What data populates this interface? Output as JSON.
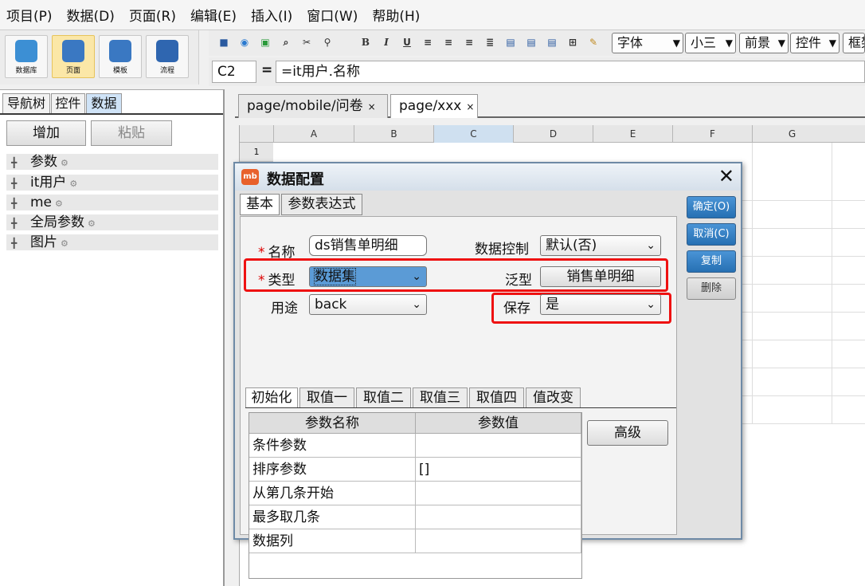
{
  "menu": [
    "项目(P)",
    "数据(D)",
    "页面(R)",
    "编辑(E)",
    "插入(I)",
    "窗口(W)",
    "帮助(H)"
  ],
  "big_tools": [
    {
      "label": "数据库",
      "icon": "database-icon"
    },
    {
      "label": "页面",
      "icon": "page-icon"
    },
    {
      "label": "模板",
      "icon": "template-icon"
    },
    {
      "label": "流程",
      "icon": "flow-icon"
    }
  ],
  "toolbar": {
    "font_family": "字体",
    "font_size": "小三",
    "select3": "前景",
    "select4": "控件",
    "select5": "框架"
  },
  "formula_bar": {
    "cell_ref": "C2",
    "eq": "=",
    "formula": "=it用户.名称"
  },
  "left_panel": {
    "tabs": [
      "导航树",
      "控件",
      "数据"
    ],
    "add_button": "增加",
    "paste_button": "粘贴",
    "tree": [
      "参数",
      "it用户",
      "me",
      "全局参数",
      "图片"
    ]
  },
  "doc_tabs": [
    {
      "label": "page/mobile/问卷",
      "close": "×"
    },
    {
      "label": "page/xxx",
      "close": "×"
    }
  ],
  "grid": {
    "columns": [
      "A",
      "B",
      "C",
      "D",
      "E",
      "F",
      "G"
    ],
    "first_row": "1"
  },
  "dialog": {
    "title": "数据配置",
    "logo": "mb",
    "close": "✕",
    "tabs": [
      "基本",
      "参数表达式"
    ],
    "name_label": "名称",
    "name_value": "ds销售单明细",
    "data_control_label": "数据控制",
    "data_control_value": "默认(否)",
    "type_label": "类型",
    "type_value": "数据集",
    "generic_label": "泛型",
    "generic_value": "销售单明细",
    "usage_label": "用途",
    "usage_value": "back",
    "save_label": "保存",
    "save_value": "是",
    "inner_tabs": [
      "初始化",
      "取值一",
      "取值二",
      "取值三",
      "取值四",
      "值改变"
    ],
    "table_headers": [
      "参数名称",
      "参数值"
    ],
    "table_rows": [
      {
        "name": "条件参数",
        "value": ""
      },
      {
        "name": "排序参数",
        "value": "[]"
      },
      {
        "name": "从第几条开始",
        "value": ""
      },
      {
        "name": "最多取几条",
        "value": ""
      },
      {
        "name": "数据列",
        "value": ""
      }
    ],
    "advanced_button": "高级",
    "side_buttons": [
      "确定(O)",
      "取消(C)",
      "复制",
      "删除"
    ]
  },
  "colors": {
    "highlight": "#ee1111",
    "primary_button": "#2670b3"
  }
}
